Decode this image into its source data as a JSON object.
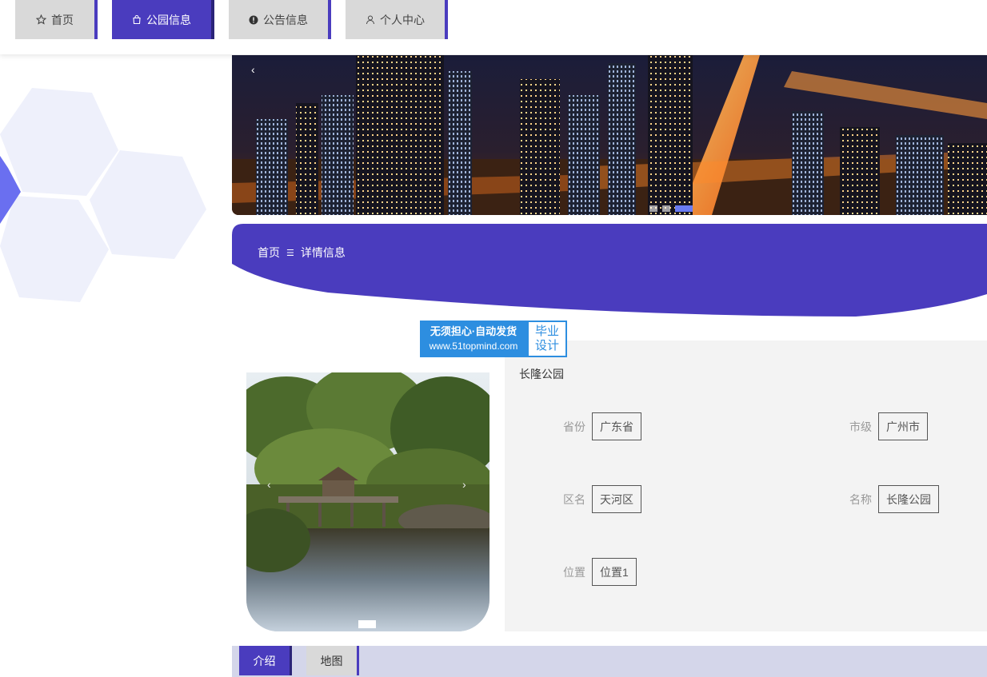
{
  "nav": {
    "items": [
      {
        "label": "首页",
        "icon": "star-icon",
        "active": false
      },
      {
        "label": "公园信息",
        "icon": "bag-icon",
        "active": true
      },
      {
        "label": "公告信息",
        "icon": "alert-icon",
        "active": false
      },
      {
        "label": "个人中心",
        "icon": "user-icon",
        "active": false
      }
    ]
  },
  "banner": {
    "prev_glyph": "‹",
    "slide_count": 3,
    "active_slide": 3
  },
  "breadcrumb": {
    "home": "首页",
    "separator": "☰",
    "current": "详情信息"
  },
  "watermark": {
    "line1": "无须担心·自动发货",
    "url": "www.51topmind.com",
    "badge_line1": "毕业",
    "badge_line2": "设计"
  },
  "photo": {
    "prev_glyph": "‹",
    "next_glyph": "›"
  },
  "detail": {
    "title": "长隆公园",
    "fields": [
      {
        "label": "省份",
        "value": "广东省"
      },
      {
        "label": "市级",
        "value": "广州市"
      },
      {
        "label": "区名",
        "value": "天河区"
      },
      {
        "label": "名称",
        "value": "长隆公园"
      },
      {
        "label": "位置",
        "value": "位置1"
      }
    ]
  },
  "tabs": [
    {
      "label": "介绍",
      "active": true
    },
    {
      "label": "地图",
      "active": false
    }
  ],
  "colors": {
    "primary": "#4a3cbe",
    "primary_dark": "#2b2478",
    "nav_inactive": "#d9d9d9",
    "tabbar_bg": "#d4d6ea",
    "watermark_blue": "#2d8ee0"
  }
}
